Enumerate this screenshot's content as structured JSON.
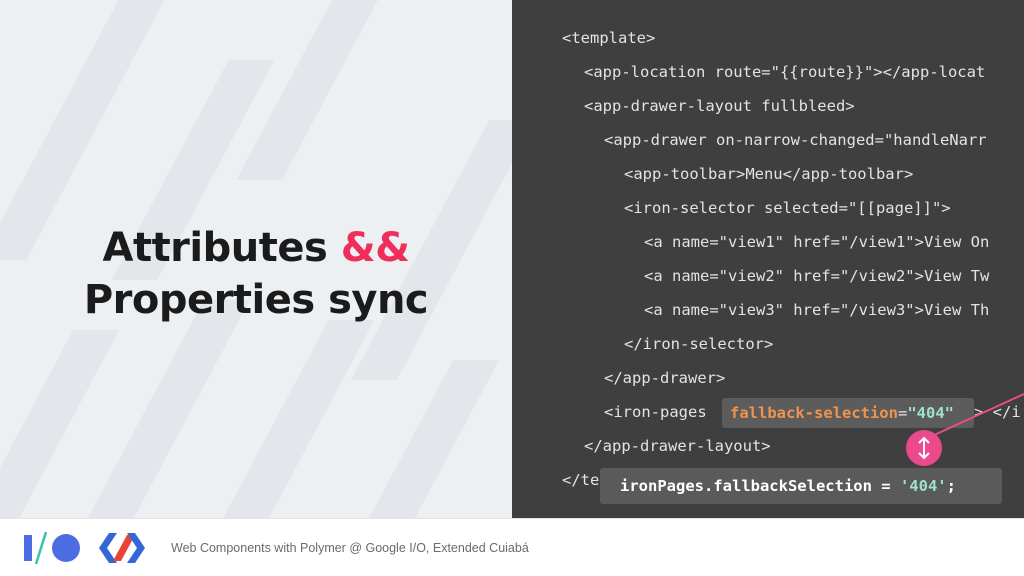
{
  "slide": {
    "title_line1": "Attributes",
    "title_accent": "&&",
    "title_line2": "Properties sync",
    "accent_color": "#ef2e5c"
  },
  "code": {
    "lines": [
      "<template>",
      "<app-location route=\"{{route}}\"></app-locat",
      "<app-drawer-layout fullbleed>",
      "<app-drawer on-narrow-changed=\"handleNarr",
      "<app-toolbar>Menu</app-toolbar>",
      "<iron-selector selected=\"[[page]]\">",
      "<a name=\"view1\" href=\"/view1\">View On",
      "<a name=\"view2\" href=\"/view2\">View Tw",
      "<a name=\"view3\" href=\"/view3\">View Th",
      "</iron-selector>",
      "</app-drawer>",
      "<iron-pages",
      "</app-drawer-layout>",
      "</te"
    ],
    "iron_pages_tail": "> </i",
    "highlight": {
      "attr": "fallback-selection",
      "eq": "=",
      "value": "\"404\""
    },
    "js_statement": {
      "text": "ironPages.fallbackSelection = ",
      "string": "'404'",
      "end": ";"
    },
    "sync_icon": "vertical-double-arrow-icon",
    "sync_color": "#ec4a8c"
  },
  "footer": {
    "text": "Web Components with Polymer @ Google I/O, Extended Cuiabá",
    "io_logo": "google-io-logo",
    "polymer_logo": "polymer-logo"
  }
}
